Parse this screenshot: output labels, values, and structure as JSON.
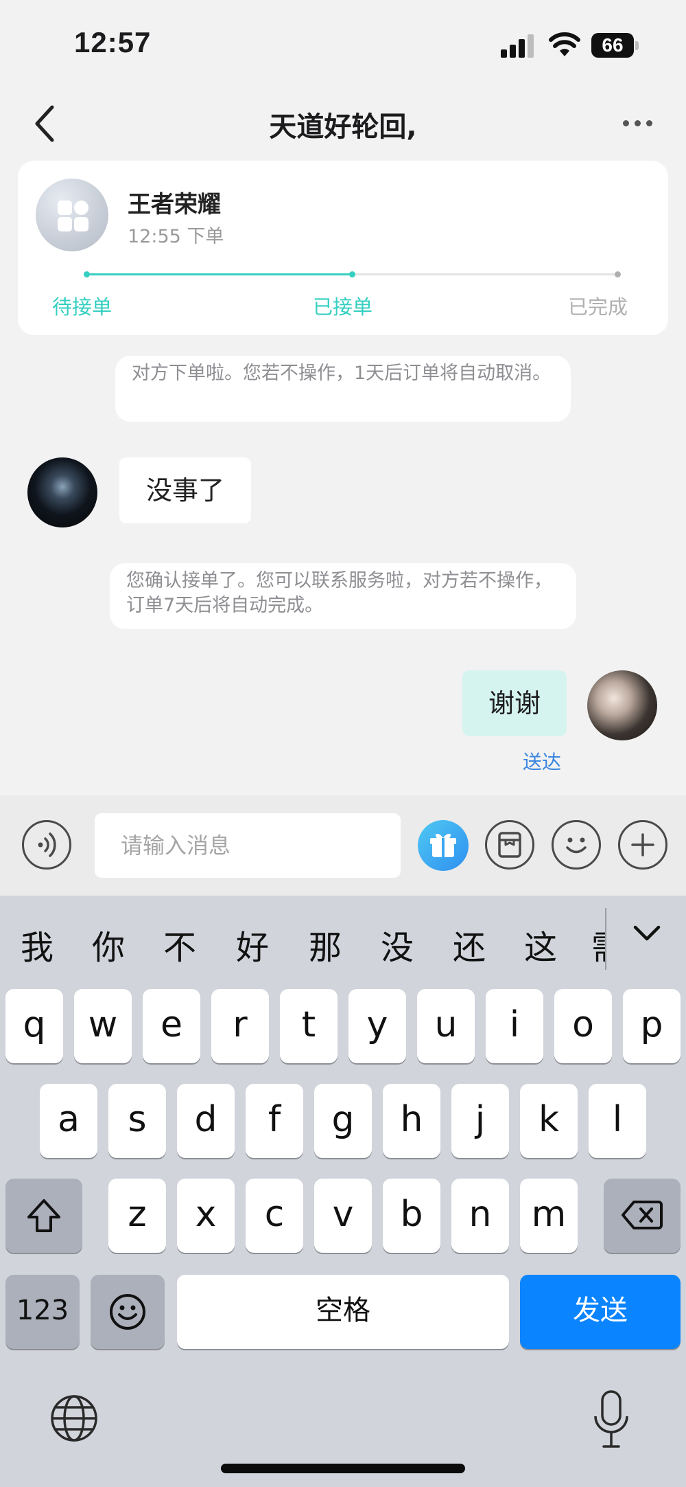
{
  "status_bar": {
    "time": "12:57",
    "battery": "66"
  },
  "header": {
    "title": "天道好轮回,"
  },
  "order": {
    "game_name": "王者荣耀",
    "time": "12:55 下单",
    "steps": [
      {
        "label": "待接单",
        "state": "done"
      },
      {
        "label": "已接单",
        "state": "current"
      },
      {
        "label": "已完成",
        "state": "pending"
      }
    ],
    "progress": 0.5,
    "colors": {
      "active": "#34cfc0",
      "inactive": "#b0b0b0"
    }
  },
  "messages": {
    "system_notice_1": "对方下单啦。您若不操作，1天后订单将自动取消。",
    "incoming": "没事了",
    "system_notice_2": "您确认接单了。您可以联系服务啦，对方若不操作，订单7天后将自动完成。",
    "outgoing": "谢谢",
    "delivery_status": "送达"
  },
  "input_bar": {
    "placeholder": "请输入消息",
    "icons": [
      "voice-icon",
      "gift-icon",
      "order-box-icon",
      "emoji-icon",
      "plus-icon"
    ]
  },
  "keyboard": {
    "candidates": [
      "我",
      "你",
      "不",
      "好",
      "那",
      "没",
      "还",
      "这",
      "需"
    ],
    "row1": [
      "q",
      "w",
      "e",
      "r",
      "t",
      "y",
      "u",
      "i",
      "o",
      "p"
    ],
    "row2": [
      "a",
      "s",
      "d",
      "f",
      "g",
      "h",
      "j",
      "k",
      "l"
    ],
    "row3": [
      "z",
      "x",
      "c",
      "v",
      "b",
      "n",
      "m"
    ],
    "numbers_key": "123",
    "space_key": "空格",
    "send_key": "发送"
  }
}
